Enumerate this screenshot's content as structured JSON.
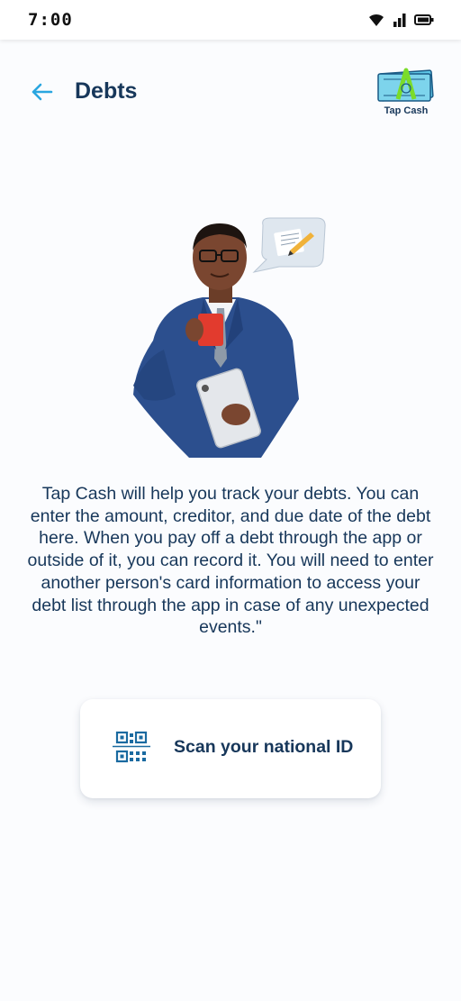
{
  "status_bar": {
    "time": "7:00",
    "icons": [
      "wifi-icon",
      "signal-icon",
      "battery-icon"
    ]
  },
  "header": {
    "title": "Debts",
    "back_icon": "arrow-left-icon",
    "logo_text": "Tap Cash"
  },
  "illustration": "businessman-with-mug-and-tablet",
  "main": {
    "description": "Tap Cash will help you track your debts. You can enter the amount, creditor, and due date of the debt here. When you pay off a debt through the app or outside of it, you can record it. You will need to enter another person's card information to access your debt list through the app in case of any unexpected events.\""
  },
  "scan_card": {
    "icon": "qr-code-icon",
    "label": "Scan your national ID"
  },
  "colors": {
    "accent": "#2aa6e0",
    "text": "#17375a",
    "background": "#fbfcfe"
  }
}
